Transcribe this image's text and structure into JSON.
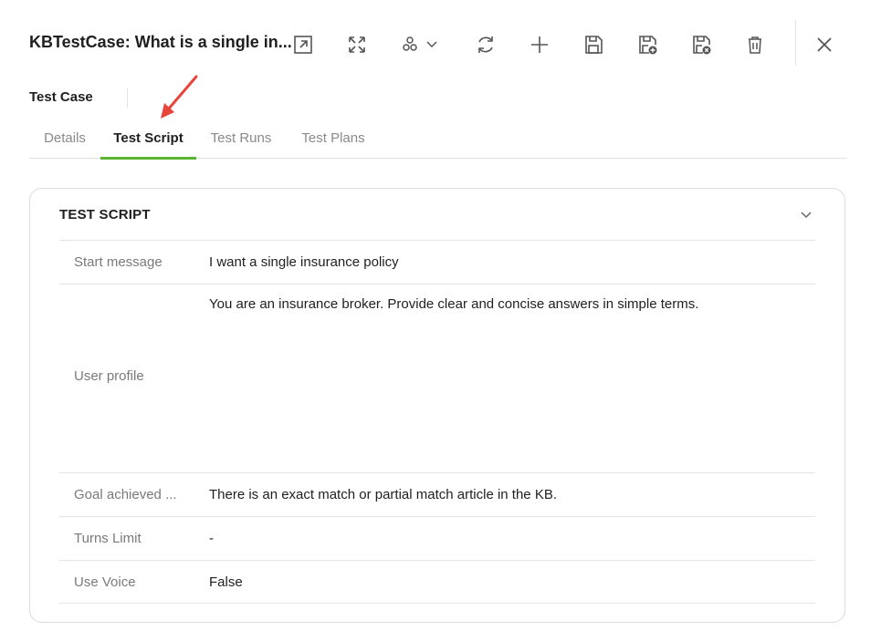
{
  "header": {
    "title": "KBTestCase: What is a single in...",
    "record_type": "Test Case"
  },
  "toolbar": {
    "icons": [
      "open-in-new-icon",
      "expand-icon",
      "apps-dropdown-icon",
      "refresh-icon",
      "add-icon",
      "save-icon",
      "save-and-new-icon",
      "save-and-close-icon",
      "delete-icon",
      "close-icon"
    ]
  },
  "tabs": [
    {
      "label": "Details"
    },
    {
      "label": "Test Script",
      "active": true
    },
    {
      "label": "Test Runs"
    },
    {
      "label": "Test Plans"
    }
  ],
  "section": {
    "title": "TEST SCRIPT",
    "rows": [
      {
        "label": "Start message",
        "value": "I want a single insurance policy"
      },
      {
        "label": "User profile",
        "value": "You are an insurance broker. Provide clear and concise answers in simple terms."
      },
      {
        "label": "Goal achieved ...",
        "value": "There is an exact match or partial match article in the KB."
      },
      {
        "label": "Turns Limit",
        "value": "-"
      },
      {
        "label": "Use Voice",
        "value": "False"
      }
    ]
  },
  "colors": {
    "active_tab_underline": "#5bb534",
    "annotation_arrow": "#e8453c"
  }
}
